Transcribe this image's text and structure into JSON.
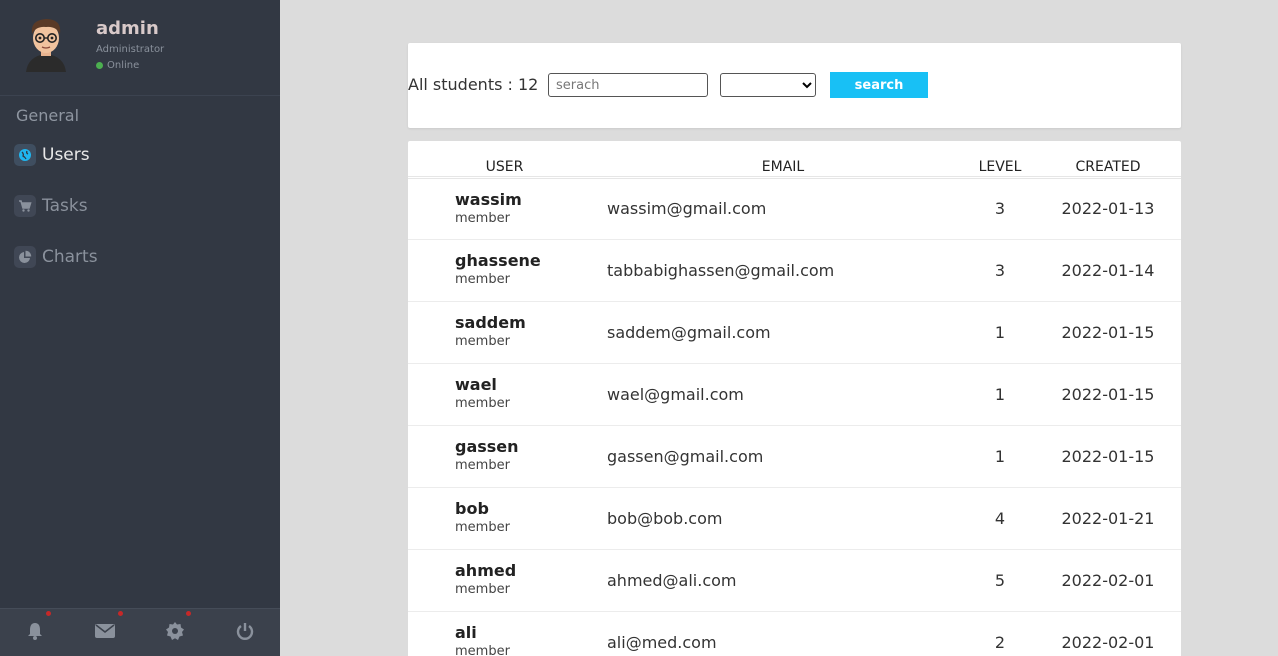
{
  "sidebar": {
    "profile": {
      "name": "admin",
      "role": "Administrator",
      "status": "Online"
    },
    "section_title": "General",
    "nav": [
      {
        "label": "Users",
        "icon": "globe-icon",
        "active": true
      },
      {
        "label": "Tasks",
        "icon": "cart-icon",
        "active": false
      },
      {
        "label": "Charts",
        "icon": "pie-chart-icon",
        "active": false
      }
    ],
    "bottom_icons": [
      "bell-icon",
      "envelope-icon",
      "gear-icon",
      "power-icon"
    ]
  },
  "search": {
    "count_label": "All students : 12",
    "placeholder": "serach",
    "button_label": "search",
    "select_value": ""
  },
  "table": {
    "headers": {
      "user": "USER",
      "email": "EMAIL",
      "level": "LEVEL",
      "created": "CREATED"
    },
    "rows": [
      {
        "name": "wassim",
        "role": "member",
        "email": "wassim@gmail.com",
        "level": "3",
        "created": "2022-01-13"
      },
      {
        "name": "ghassene",
        "role": "member",
        "email": "tabbabighassen@gmail.com",
        "level": "3",
        "created": "2022-01-14"
      },
      {
        "name": "saddem",
        "role": "member",
        "email": "saddem@gmail.com",
        "level": "1",
        "created": "2022-01-15"
      },
      {
        "name": "wael",
        "role": "member",
        "email": "wael@gmail.com",
        "level": "1",
        "created": "2022-01-15"
      },
      {
        "name": "gassen",
        "role": "member",
        "email": "gassen@gmail.com",
        "level": "1",
        "created": "2022-01-15"
      },
      {
        "name": "bob",
        "role": "member",
        "email": "bob@bob.com",
        "level": "4",
        "created": "2022-01-21"
      },
      {
        "name": "ahmed",
        "role": "member",
        "email": "ahmed@ali.com",
        "level": "5",
        "created": "2022-02-01"
      },
      {
        "name": "ali",
        "role": "member",
        "email": "ali@med.com",
        "level": "2",
        "created": "2022-02-01"
      }
    ]
  },
  "colors": {
    "sidebar_bg": "#323843",
    "accent": "#18c0f5",
    "page_bg": "#dcdcdc",
    "status_online": "#4caf50",
    "notif": "#c62828"
  }
}
